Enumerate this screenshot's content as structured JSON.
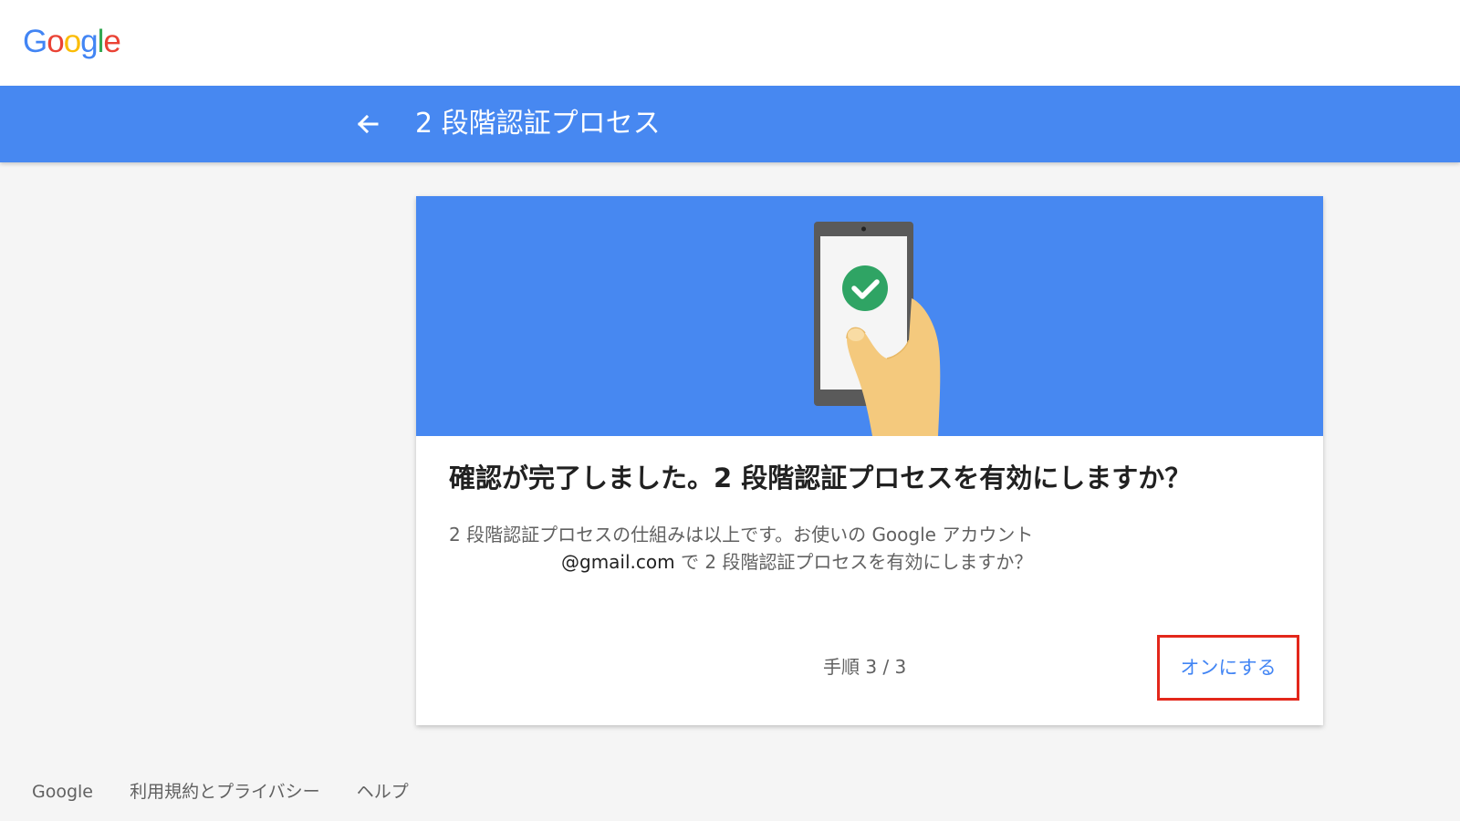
{
  "brand": {
    "logo_letters": [
      {
        "char": "G",
        "color": "#4285F4"
      },
      {
        "char": "o",
        "color": "#EA4335"
      },
      {
        "char": "o",
        "color": "#FBBC05"
      },
      {
        "char": "g",
        "color": "#4285F4"
      },
      {
        "char": "l",
        "color": "#34A853"
      },
      {
        "char": "e",
        "color": "#EA4335"
      }
    ],
    "logo_text": "Google"
  },
  "header": {
    "back_icon": "arrow-left-icon",
    "title": "2 段階認証プロセス",
    "background": "#4788F1"
  },
  "card": {
    "illustration": "phone-with-checkmark-in-hand",
    "heading": "確認が完了しました。2 段階認証プロセスを有効にしますか？",
    "description_line1": "2 段階認証プロセスの仕組みは以上です。お使いの Google アカウント",
    "description_email": "@gmail.com",
    "description_line2_rest": " で 2 段階認証プロセスを有効にしますか？",
    "step_label": "手順 3 / 3",
    "primary_button": "オンにする",
    "button_highlight": "#E3271B"
  },
  "footer": {
    "links": [
      "Google",
      "利用規約とプライバシー",
      "ヘルプ"
    ]
  },
  "colors": {
    "accent_blue": "#4285F4",
    "check_green": "#2FA464"
  }
}
